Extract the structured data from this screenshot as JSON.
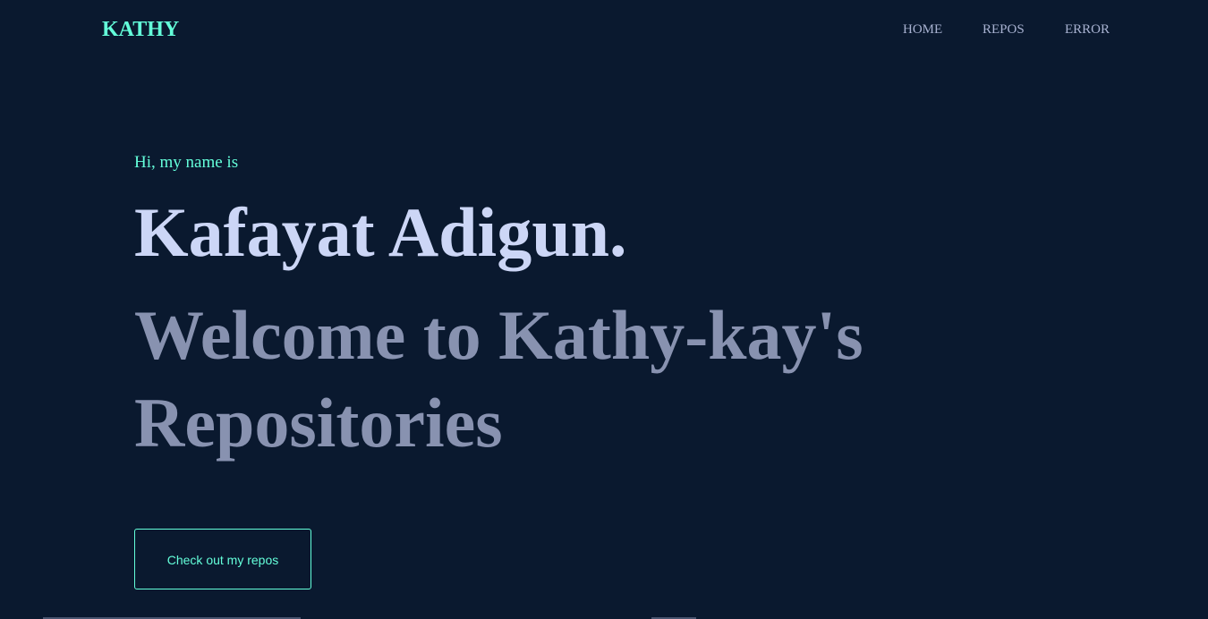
{
  "header": {
    "logo": "KATHY",
    "nav": {
      "home": "HOME",
      "repos": "REPOS",
      "error": "ERROR"
    }
  },
  "hero": {
    "intro": "Hi, my name is",
    "name": "Kafayat Adigun.",
    "welcome": "Welcome to Kathy-kay's Repositories",
    "cta_label": "Check out my repos"
  },
  "colors": {
    "background": "#0a192f",
    "accent": "#64ffda",
    "heading": "#ccd6f6",
    "muted": "#8892b0",
    "nav_text": "#a8b2d1"
  }
}
